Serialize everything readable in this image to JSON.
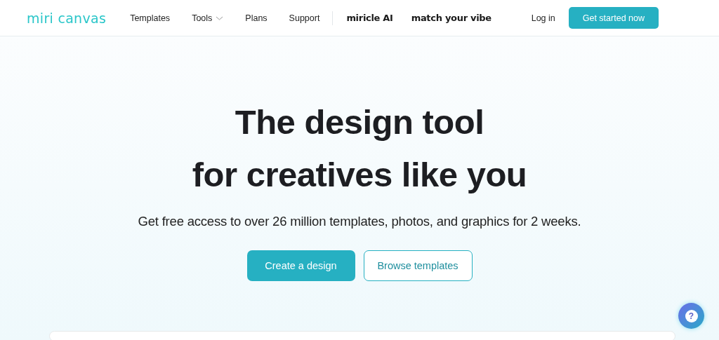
{
  "header": {
    "logo": "miri canvas",
    "nav": [
      {
        "label": "Templates",
        "dropdown": false
      },
      {
        "label": "Tools",
        "dropdown": true
      },
      {
        "label": "Plans",
        "dropdown": false
      },
      {
        "label": "Support",
        "dropdown": false
      }
    ],
    "brand_links": [
      "miricle AI",
      "match your vibe"
    ],
    "login": "Log in",
    "cta": "Get started now"
  },
  "hero": {
    "title_lines": [
      "The design tool",
      "for creatives like you"
    ],
    "subtitle": "Get free access to over 26 million templates, photos, and graphics for 2 weeks.",
    "buttons": [
      {
        "label": "Create a design",
        "kind": "primary"
      },
      {
        "label": "Browse templates",
        "kind": "outline"
      }
    ]
  },
  "help_button": "?"
}
